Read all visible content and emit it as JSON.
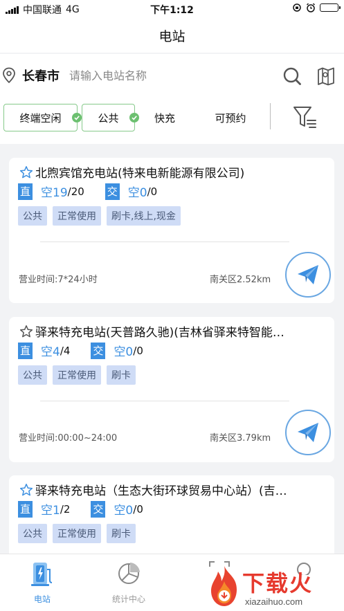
{
  "status_bar": {
    "carrier": "中国联通",
    "network": "4G",
    "time": "下午1:12"
  },
  "nav": {
    "title": "电站"
  },
  "search": {
    "city": "长春市",
    "placeholder": "请输入电站名称"
  },
  "filters": [
    {
      "label": "终端空闲",
      "active": true
    },
    {
      "label": "公共",
      "active": true
    },
    {
      "label": "快充",
      "active": false
    },
    {
      "label": "可预约",
      "active": false
    }
  ],
  "stations": [
    {
      "name": "北煦宾馆充电站(特来电新能源有限公司)",
      "dc_label": "直",
      "dc_free": "空19",
      "dc_total": "/20",
      "ac_label": "交",
      "ac_free": "空0",
      "ac_total": "/0",
      "tags": [
        "公共",
        "正常使用",
        "刷卡,线上,现金"
      ],
      "hours": "营业时间:7*24小时",
      "distance": "南关区2.52km"
    },
    {
      "name": "驿来特充电站(天普路久驰)(吉林省驿来特智能…",
      "dc_label": "直",
      "dc_free": "空4",
      "dc_total": "/4",
      "ac_label": "交",
      "ac_free": "空0",
      "ac_total": "/0",
      "tags": [
        "公共",
        "正常使用",
        "刷卡"
      ],
      "hours": "营业时间:00:00~24:00",
      "distance": "南关区3.79km"
    },
    {
      "name": "驿来特充电站（生态大街环球贸易中心站）(吉…",
      "dc_label": "直",
      "dc_free": "空1",
      "dc_total": "/2",
      "ac_label": "交",
      "ac_free": "空0",
      "ac_total": "/0",
      "tags": [
        "公共",
        "正常使用",
        "刷卡"
      ]
    }
  ],
  "tabbar": {
    "tabs": [
      {
        "label": "电站",
        "color": "#3c8fe0"
      },
      {
        "label": "统计中心",
        "color": "#999999"
      }
    ]
  },
  "watermark": {
    "text": "下载火",
    "url": "xiazaihuo.com"
  },
  "colors": {
    "accent": "#3c8fe0",
    "active_chip_border": "#86c98a",
    "tag_bg": "#cfdcf6",
    "watermark": "#e63a2e"
  }
}
